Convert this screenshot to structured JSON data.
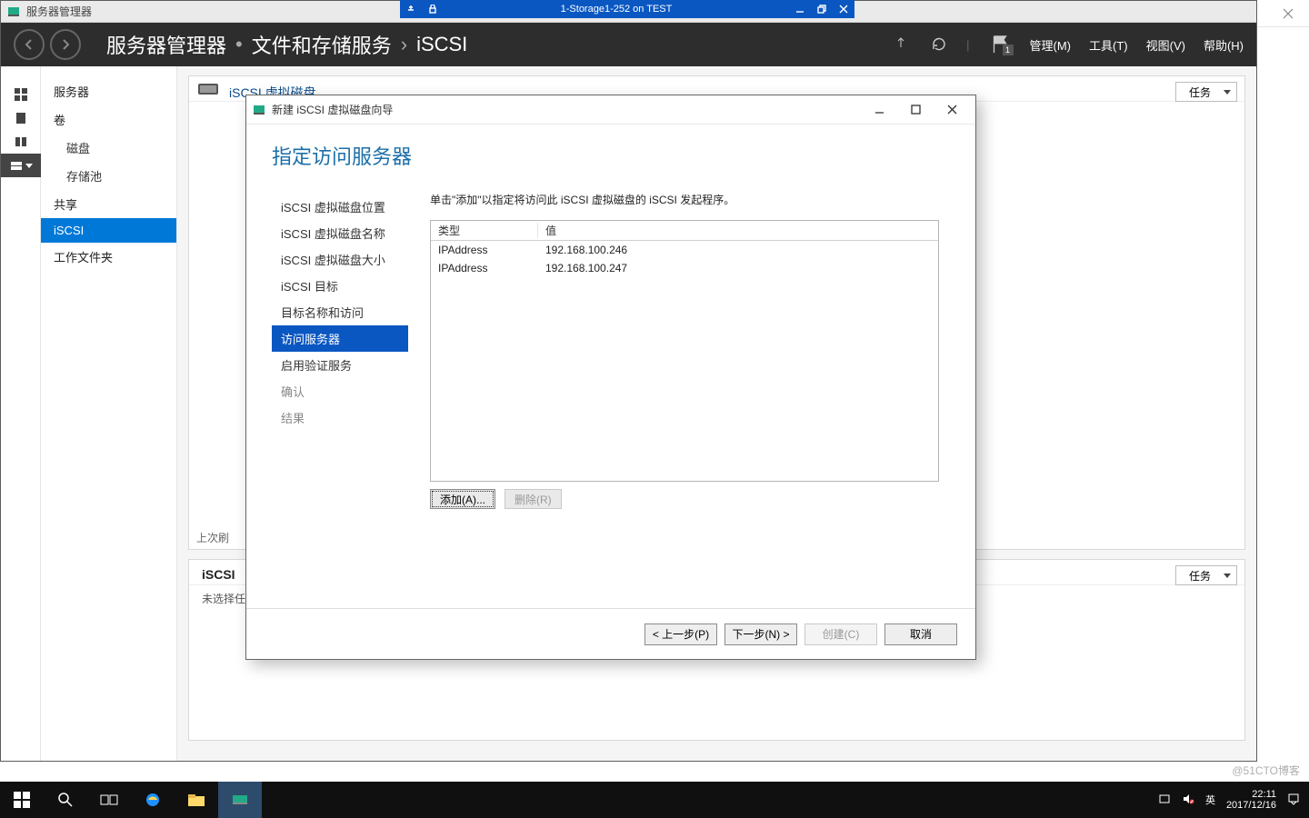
{
  "host": {
    "title_spacer": ""
  },
  "vm": {
    "title": "1-Storage1-252 on TEST"
  },
  "server_manager": {
    "window_title": "服务器管理器",
    "crumb1": "服务器管理器",
    "crumb2": "文件和存储服务",
    "crumb3": "iSCSI",
    "menu": {
      "manage": "管理(M)",
      "tools": "工具(T)",
      "view": "视图(V)",
      "help": "帮助(H)"
    },
    "nav": {
      "servers": "服务器",
      "volumes": "卷",
      "disks": "磁盘",
      "pools": "存储池",
      "shares": "共享",
      "iscsi": "iSCSI",
      "work": "工作文件夹"
    },
    "panel_top": {
      "title": "iSCSI 虚拟磁盘",
      "tasks": "任务",
      "last": "上次刷"
    },
    "panel_bottom": {
      "title": "iSCSI",
      "unselected": "未选择任",
      "tasks": "任务"
    }
  },
  "wizard": {
    "title": "新建 iSCSI 虚拟磁盘向导",
    "heading": "指定访问服务器",
    "steps": {
      "loc": "iSCSI 虚拟磁盘位置",
      "name": "iSCSI 虚拟磁盘名称",
      "size": "iSCSI 虚拟磁盘大小",
      "target": "iSCSI 目标",
      "tname": "目标名称和访问",
      "access": "访问服务器",
      "auth": "启用验证服务",
      "confirm": "确认",
      "result": "结果"
    },
    "instr": "单击\"添加\"以指定将访问此 iSCSI 虚拟磁盘的 iSCSI 发起程序。",
    "col_type": "类型",
    "col_value": "值",
    "rows": [
      {
        "type": "IPAddress",
        "value": "192.168.100.246"
      },
      {
        "type": "IPAddress",
        "value": "192.168.100.247"
      }
    ],
    "btn_add": "添加(A)...",
    "btn_remove": "删除(R)",
    "btn_prev": "< 上一步(P)",
    "btn_next": "下一步(N) >",
    "btn_create": "创建(C)",
    "btn_cancel": "取消"
  },
  "taskbar": {
    "ime": "英",
    "time": "22:11",
    "date": "2017/12/16"
  },
  "watermark": "@51CTO博客",
  "flag_badge": "1"
}
